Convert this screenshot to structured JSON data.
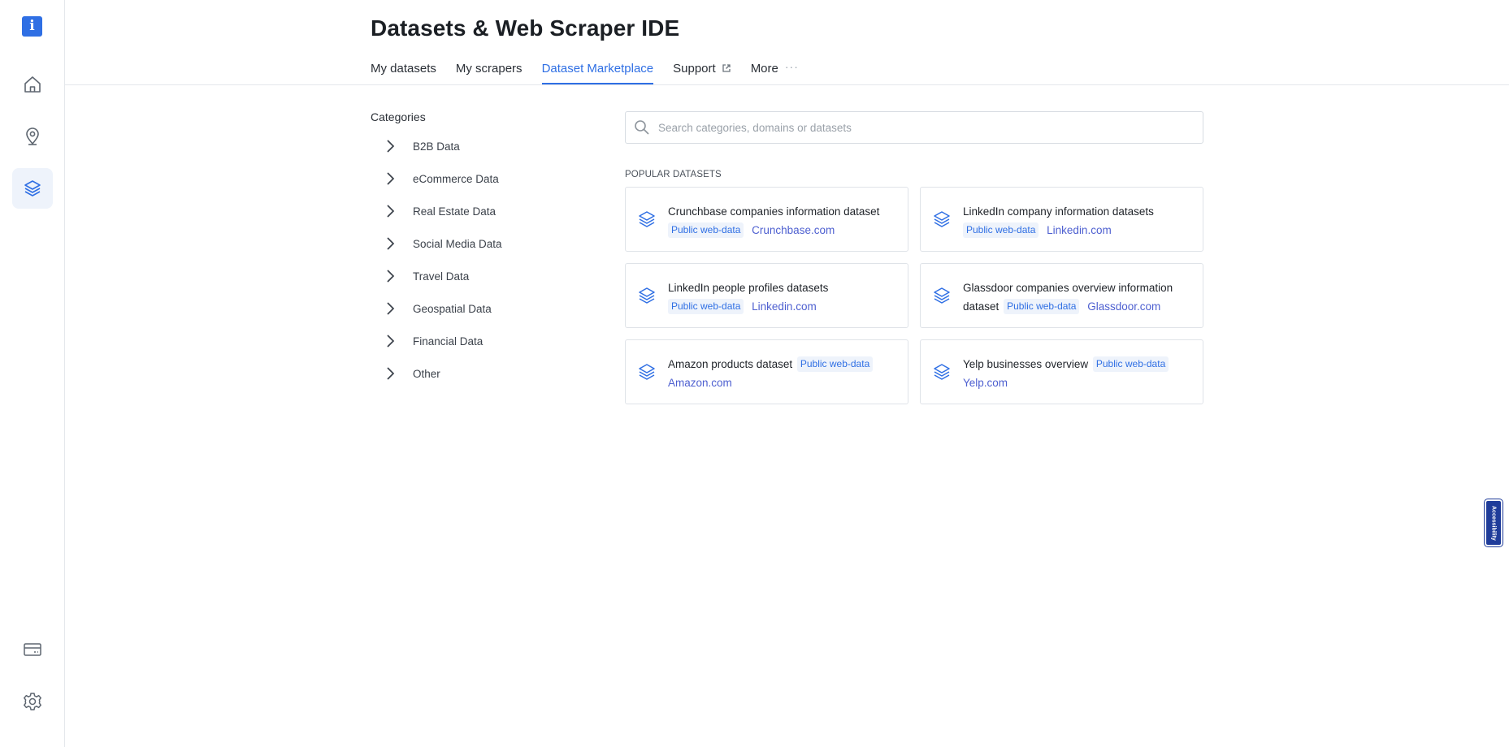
{
  "app": {
    "logo_letter": "i",
    "title": "Datasets & Web Scraper IDE"
  },
  "colors": {
    "accent": "#2f6fe4",
    "domain_link": "#4d5fd0",
    "badge_bg": "#eef3fb"
  },
  "sidebar": {
    "items": [
      {
        "icon": "home-icon"
      },
      {
        "icon": "location-pin-icon"
      },
      {
        "icon": "layers-icon",
        "active": true
      }
    ],
    "bottom": [
      {
        "icon": "credit-card-icon"
      },
      {
        "icon": "gear-icon"
      }
    ]
  },
  "tabs": [
    {
      "label": "My datasets"
    },
    {
      "label": "My scrapers"
    },
    {
      "label": "Dataset Marketplace",
      "active": true
    },
    {
      "label": "Support",
      "icon": "external-link-icon"
    },
    {
      "label": "More",
      "icon": "ellipsis-icon"
    }
  ],
  "categories": {
    "title": "Categories",
    "items": [
      {
        "label": "B2B Data"
      },
      {
        "label": "eCommerce Data"
      },
      {
        "label": "Real Estate Data"
      },
      {
        "label": "Social Media Data"
      },
      {
        "label": "Travel Data"
      },
      {
        "label": "Geospatial Data"
      },
      {
        "label": "Financial Data"
      },
      {
        "label": "Other"
      }
    ]
  },
  "search": {
    "placeholder": "Search categories, domains or datasets",
    "value": ""
  },
  "popular": {
    "title": "POPULAR DATASETS",
    "datasets": [
      {
        "name": "Crunchbase companies information dataset",
        "badge": "Public web-data",
        "domain": "Crunchbase.com"
      },
      {
        "name": "LinkedIn company information datasets",
        "badge": "Public web-data",
        "domain": "Linkedin.com"
      },
      {
        "name": "LinkedIn people profiles datasets",
        "badge": "Public web-data",
        "domain": "Linkedin.com"
      },
      {
        "name": "Glassdoor companies overview information dataset",
        "badge": "Public web-data",
        "domain": "Glassdoor.com"
      },
      {
        "name": "Amazon products dataset",
        "badge": "Public web-data",
        "domain": "Amazon.com"
      },
      {
        "name": "Yelp businesses overview",
        "badge": "Public web-data",
        "domain": "Yelp.com"
      }
    ]
  },
  "accessibility": {
    "label": "Accessibility"
  }
}
